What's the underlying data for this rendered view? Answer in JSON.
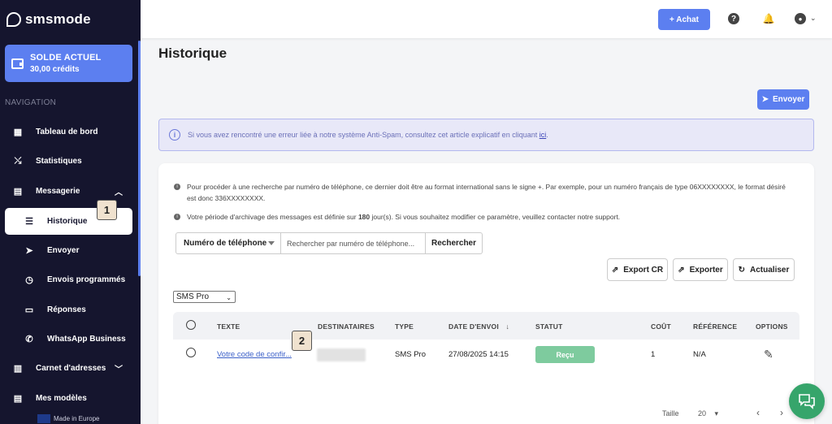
{
  "app": {
    "brand": "smsmode"
  },
  "sidebar": {
    "balance": {
      "title": "SOLDE ACTUEL",
      "amount": "30,00 crédits"
    },
    "nav_label": "NAVIGATION",
    "items": [
      {
        "label": "Tableau de bord",
        "icon": "dashboard-icon"
      },
      {
        "label": "Statistiques",
        "icon": "chart-icon"
      },
      {
        "label": "Messagerie",
        "icon": "messages-icon",
        "expanded": true
      },
      {
        "label": "Historique",
        "icon": "list-icon",
        "active": true
      },
      {
        "label": "Envoyer",
        "icon": "send-icon"
      },
      {
        "label": "Envois programmés",
        "icon": "clock-icon"
      },
      {
        "label": "Réponses",
        "icon": "inbox-icon"
      },
      {
        "label": "WhatsApp Business",
        "icon": "phone-icon"
      },
      {
        "label": "Carnet d'adresses",
        "icon": "addressbook-icon"
      },
      {
        "label": "Mes modèles",
        "icon": "templates-icon"
      }
    ],
    "footer": "Made in Europe"
  },
  "topbar": {
    "achat_label": "+ Achat"
  },
  "main": {
    "title": "Historique",
    "send_label": "Envoyer",
    "alert": {
      "text": "Si vous avez rencontré une erreur liée à notre système Anti-Spam, consultez cet article explicatif en cliquant",
      "link": "ici",
      "end": "."
    },
    "hints": {
      "phone_1": "Pour procéder à une recherche par numéro de téléphone, ce dernier doit être au format international sans le signe +. Par exemple, pour un numéro français de type 06XXXXXXXX, le format désiré",
      "phone_2": "est donc 336XXXXXXXX.",
      "archive_before": "Votre période d'archivage des messages est définie sur ",
      "archive_days": "180",
      "archive_after": " jour(s). Si vous souhaitez modifier ce paramètre, veuillez contacter notre support."
    },
    "search": {
      "type_label": "Numéro de téléphone",
      "placeholder": "Rechercher par numéro de téléphone...",
      "button": "Rechercher"
    },
    "actions": {
      "export_cr": "Export CR",
      "exporter": "Exporter",
      "actualiser": "Actualiser"
    },
    "filter": {
      "selected": "SMS Pro"
    },
    "table": {
      "headers": {
        "texte": "TEXTE",
        "destinataires": "DESTINATAIRES",
        "type": "TYPE",
        "date": "DATE D'ENVOI",
        "statut": "STATUT",
        "cout": "COÛT",
        "reference": "RÉFÉRENCE",
        "options": "OPTIONS"
      },
      "rows": [
        {
          "texte": "Votre code de confir...",
          "type": "SMS Pro",
          "date": "27/08/2025 14:15",
          "statut": "Reçu",
          "cout": "1",
          "reference": "N/A"
        }
      ]
    },
    "pagination": {
      "label": "Taille",
      "size": "20"
    }
  },
  "annotations": [
    "1",
    "2"
  ]
}
